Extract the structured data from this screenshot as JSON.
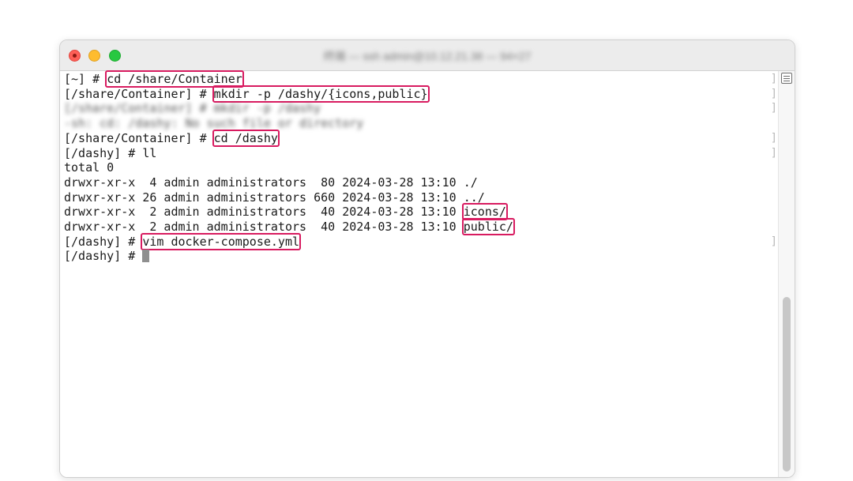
{
  "window": {
    "title": "终端 — ssh admin@10.12.21.38 — 94×27"
  },
  "terminal": {
    "lines": [
      {
        "prompt": "[~] # ",
        "command": "cd /share/Container",
        "highlight": true
      },
      {
        "prompt": "[/share/Container] # ",
        "command": "mkdir -p /dashy/{icons,public}",
        "highlight": true
      },
      {
        "text": "[/share/Container] # mkdir -p /dashy",
        "blurred": true
      },
      {
        "text": "-sh: cd: /dashy: No such file or directory",
        "blurred": true
      },
      {
        "prompt": "[/share/Container] # ",
        "command": "cd /dashy",
        "highlight": true
      },
      {
        "text": "[/dashy] # ll"
      },
      {
        "text": "total 0"
      },
      {
        "text": "drwxr-xr-x  4 admin administrators  80 2024-03-28 13:10 ./"
      },
      {
        "text": "drwxr-xr-x 26 admin administrators 660 2024-03-28 13:10 ../"
      },
      {
        "text": "drwxr-xr-x  2 admin administrators  40 2024-03-28 13:10 ",
        "name": "icons/",
        "highlight": true
      },
      {
        "text": "drwxr-xr-x  2 admin administrators  40 2024-03-28 13:10 ",
        "name": "public/",
        "highlight": true
      },
      {
        "prompt": "[/dashy] # ",
        "command": "vim docker-compose.yml",
        "highlight": true
      },
      {
        "prompt": "[/dashy] # ",
        "cursor": true
      }
    ],
    "highlight_color": "#d81b60",
    "cursor_color": "#8f8f8f"
  },
  "icons": {
    "close": "close-dot",
    "minimize": "minimize-dot",
    "maximize": "maximize-dot",
    "scroll_menu": "list-icon"
  }
}
